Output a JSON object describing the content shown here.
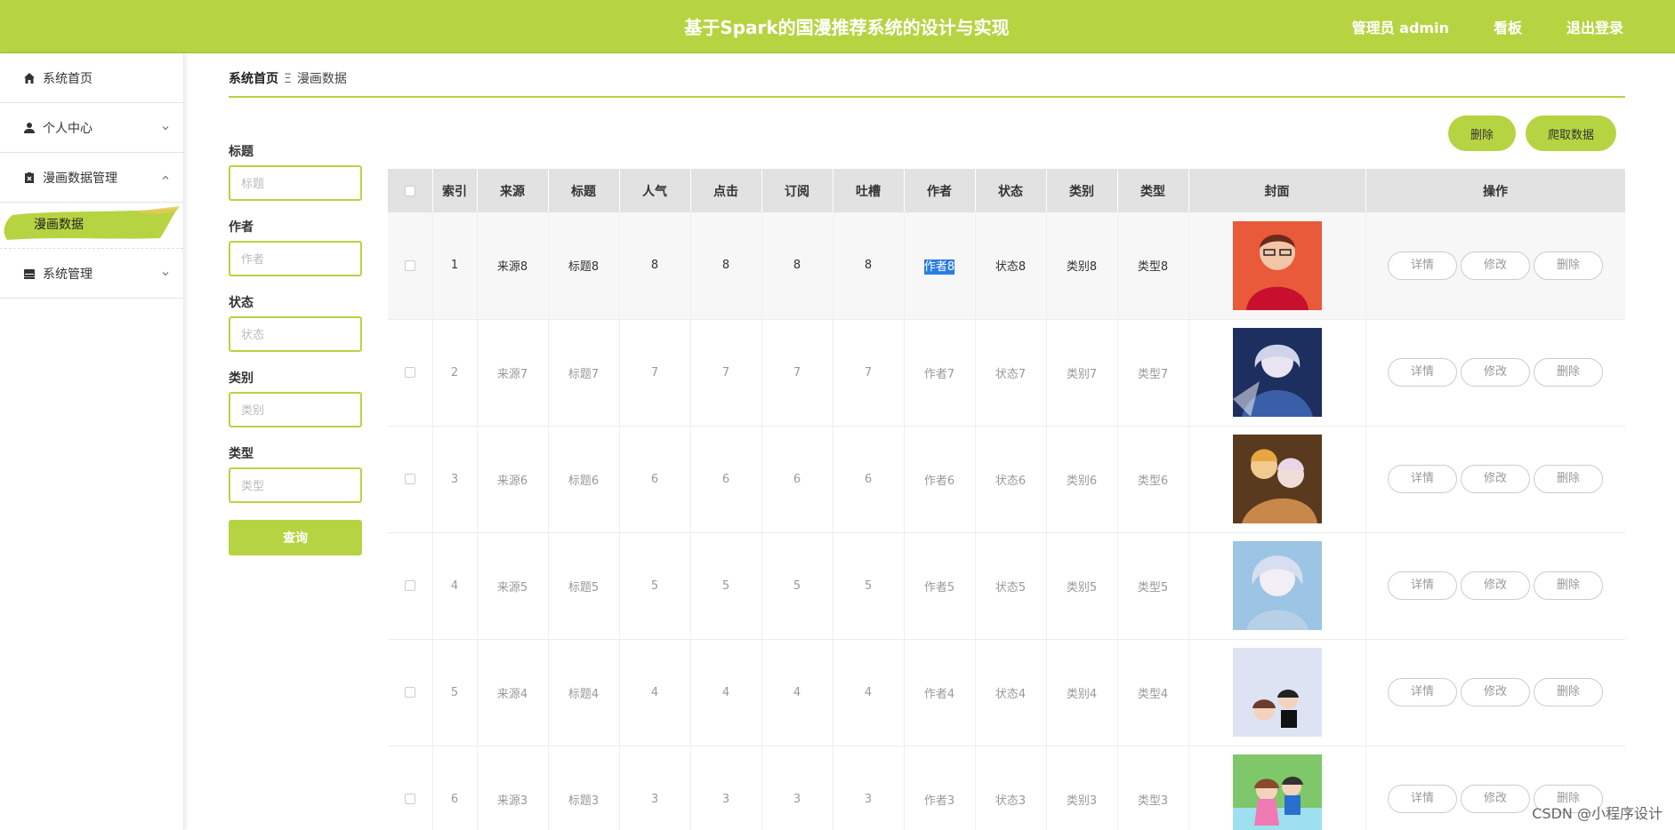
{
  "header": {
    "title": "基于Spark的国漫推荐系统的设计与实现",
    "user": "管理员 admin",
    "board": "看板",
    "logout": "退出登录"
  },
  "sidebar": {
    "items": [
      {
        "label": "系统首页",
        "icon": "home-icon"
      },
      {
        "label": "个人中心",
        "icon": "user-icon"
      },
      {
        "label": "漫画数据管理",
        "icon": "clipboard-icon"
      },
      {
        "label": "系统管理",
        "icon": "drawer-icon"
      }
    ],
    "submenu_active": "漫画数据"
  },
  "breadcrumb": {
    "home": "系统首页",
    "separator": "Ξ",
    "current": "漫画数据"
  },
  "filters": [
    {
      "label": "标题",
      "placeholder": "标题"
    },
    {
      "label": "作者",
      "placeholder": "作者"
    },
    {
      "label": "状态",
      "placeholder": "状态"
    },
    {
      "label": "类别",
      "placeholder": "类别"
    },
    {
      "label": "类型",
      "placeholder": "类型"
    }
  ],
  "query_button": "查询",
  "actions": {
    "delete": "删除",
    "crawl": "爬取数据"
  },
  "table": {
    "columns": [
      "索引",
      "来源",
      "标题",
      "人气",
      "点击",
      "订阅",
      "吐槽",
      "作者",
      "状态",
      "类别",
      "类型",
      "封面",
      "操作"
    ],
    "rows": [
      {
        "idx": "1",
        "source": "来源8",
        "title": "标题8",
        "pop": "8",
        "click": "8",
        "sub": "8",
        "comment": "8",
        "author": "作者8",
        "status": "状态8",
        "category": "类别8",
        "type": "类型8"
      },
      {
        "idx": "2",
        "source": "来源7",
        "title": "标题7",
        "pop": "7",
        "click": "7",
        "sub": "7",
        "comment": "7",
        "author": "作者7",
        "status": "状态7",
        "category": "类别7",
        "type": "类型7"
      },
      {
        "idx": "3",
        "source": "来源6",
        "title": "标题6",
        "pop": "6",
        "click": "6",
        "sub": "6",
        "comment": "6",
        "author": "作者6",
        "status": "状态6",
        "category": "类别6",
        "type": "类型6"
      },
      {
        "idx": "4",
        "source": "来源5",
        "title": "标题5",
        "pop": "5",
        "click": "5",
        "sub": "5",
        "comment": "5",
        "author": "作者5",
        "status": "状态5",
        "category": "类别5",
        "type": "类型5"
      },
      {
        "idx": "5",
        "source": "来源4",
        "title": "标题4",
        "pop": "4",
        "click": "4",
        "sub": "4",
        "comment": "4",
        "author": "作者4",
        "status": "状态4",
        "category": "类别4",
        "type": "类型4"
      },
      {
        "idx": "6",
        "source": "来源3",
        "title": "标题3",
        "pop": "3",
        "click": "3",
        "sub": "3",
        "comment": "3",
        "author": "作者3",
        "status": "状态3",
        "category": "类别3",
        "type": "类型3"
      }
    ],
    "row_ops": [
      "详情",
      "修改",
      "删除"
    ]
  },
  "colors": {
    "accent": "#b6d442",
    "header_bg": "#e2e2e2",
    "selection": "#2a7de1"
  },
  "watermark": "CSDN @小程序设计"
}
